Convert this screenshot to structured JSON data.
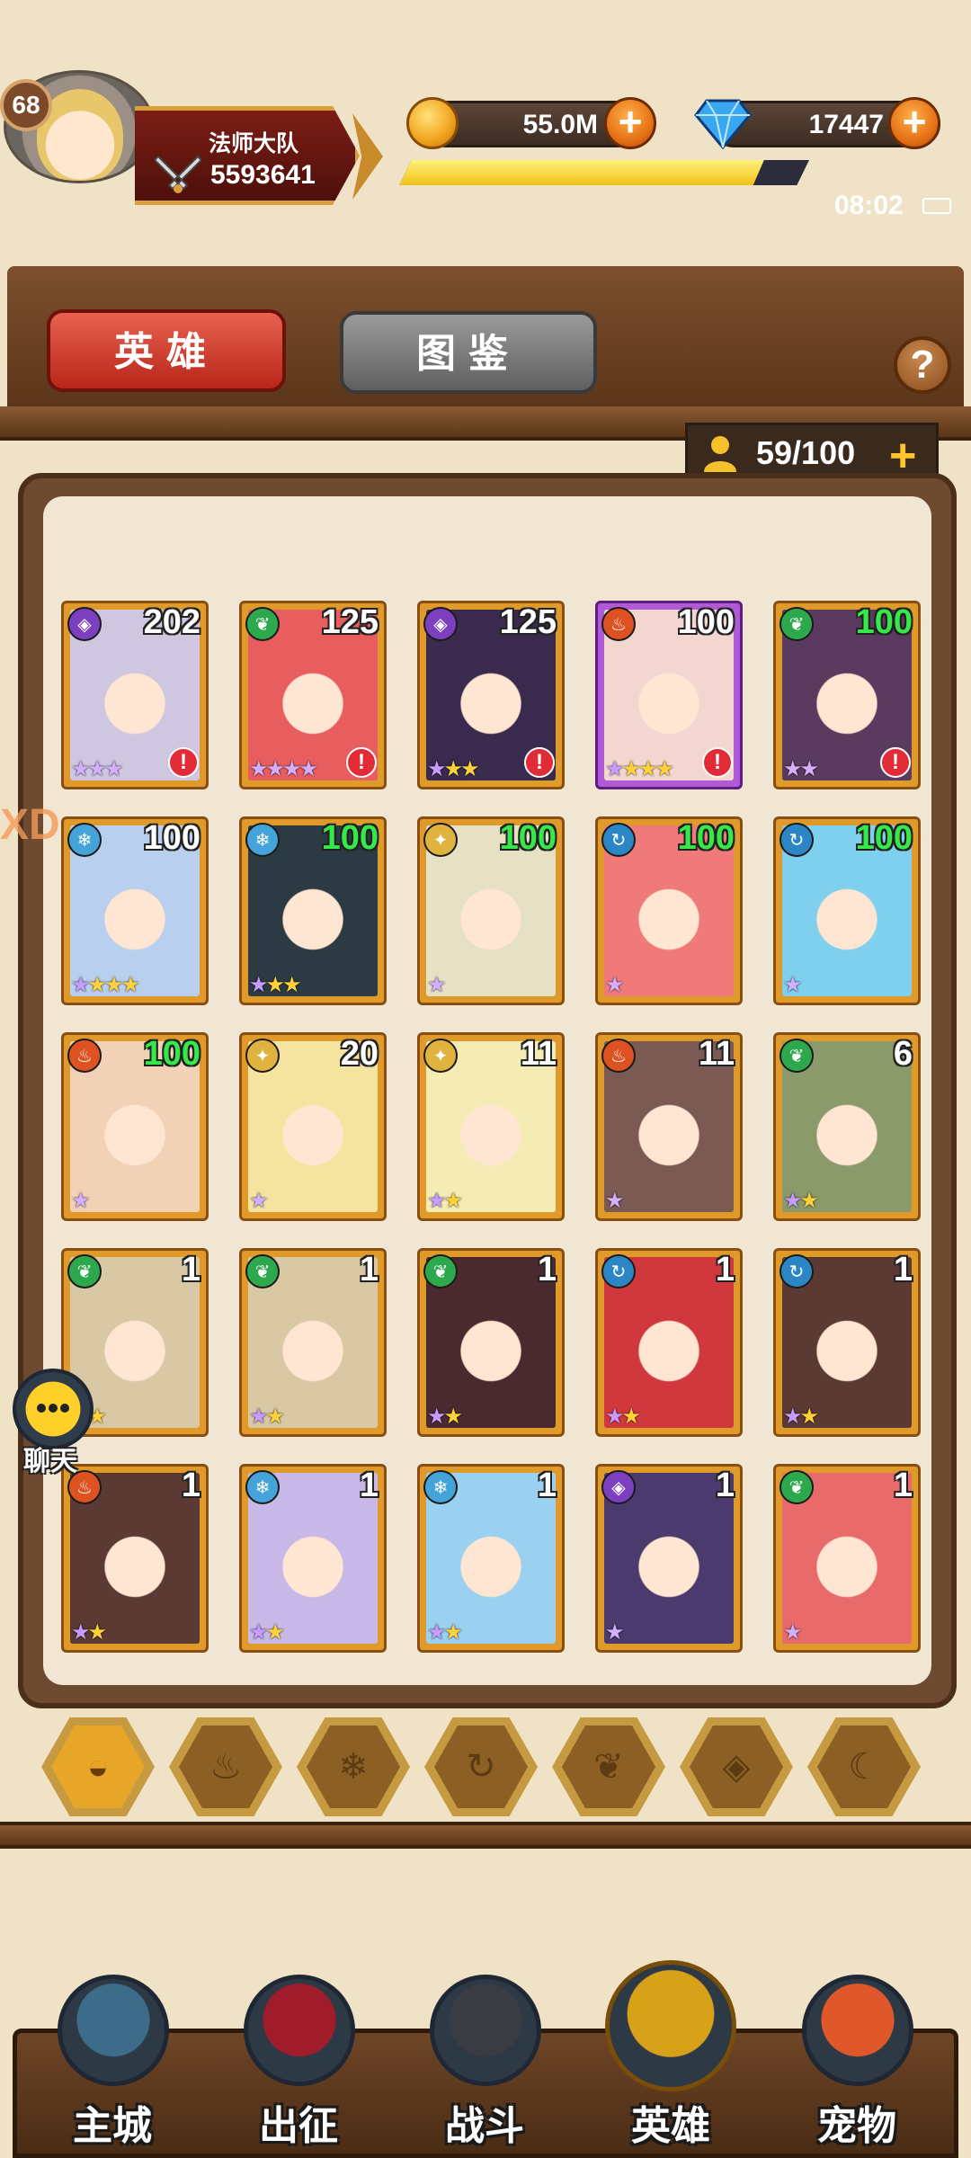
{
  "player": {
    "level": "68",
    "guild_name": "法师大队",
    "power": "5593641",
    "xp_fraction": 0.89
  },
  "resources": {
    "gold": "55.0M",
    "gems": "17447"
  },
  "status": {
    "time": "08:02"
  },
  "tabs": {
    "heroes": "英雄",
    "codex": "图鉴",
    "help": "?"
  },
  "capacity": {
    "text": "59/100",
    "plus": "+"
  },
  "left_edge_text": "XD",
  "chat": {
    "label": "聊天"
  },
  "filters": [
    "all-icon",
    "fire-icon",
    "ice-icon",
    "wind-icon",
    "nature-icon",
    "arcane-icon",
    "moon-icon"
  ],
  "heroes": [
    {
      "level": "202",
      "element": "arcane",
      "stars": 3,
      "star_color": "purple",
      "frame": "gold",
      "alert": true,
      "level_green": false,
      "art": "#cfc6e0"
    },
    {
      "level": "125",
      "element": "nature",
      "stars": 4,
      "star_color": "purple",
      "frame": "gold",
      "alert": true,
      "level_green": false,
      "art": "#e85d5d"
    },
    {
      "level": "125",
      "element": "arcane",
      "stars": 3,
      "star_color": "gold",
      "frame": "gold",
      "alert": true,
      "level_green": false,
      "art": "#3a2a4e"
    },
    {
      "level": "100",
      "element": "fire",
      "stars": 4,
      "star_color": "gold",
      "frame": "purple",
      "alert": true,
      "level_green": false,
      "art": "#f3d6d0"
    },
    {
      "level": "100",
      "element": "nature",
      "stars": 2,
      "star_color": "purple",
      "frame": "gold",
      "alert": true,
      "level_green": true,
      "art": "#5a3a5e"
    },
    {
      "level": "100",
      "element": "ice",
      "stars": 4,
      "star_color": "gold",
      "frame": "gold",
      "alert": false,
      "level_green": false,
      "art": "#b8cfee"
    },
    {
      "level": "100",
      "element": "ice",
      "stars": 3,
      "star_color": "gold",
      "frame": "gold",
      "alert": false,
      "level_green": true,
      "art": "#2c3a44"
    },
    {
      "level": "100",
      "element": "light",
      "stars": 1,
      "star_color": "purple",
      "frame": "gold",
      "alert": false,
      "level_green": true,
      "art": "#e6e0c4"
    },
    {
      "level": "100",
      "element": "wind",
      "stars": 1,
      "star_color": "purple",
      "frame": "gold",
      "alert": false,
      "level_green": true,
      "art": "#f07a7a"
    },
    {
      "level": "100",
      "element": "wind",
      "stars": 1,
      "star_color": "purple",
      "frame": "gold",
      "alert": false,
      "level_green": true,
      "art": "#7fd0ee"
    },
    {
      "level": "100",
      "element": "fire",
      "stars": 1,
      "star_color": "purple",
      "frame": "gold",
      "alert": false,
      "level_green": true,
      "art": "#f2d2b6"
    },
    {
      "level": "20",
      "element": "light",
      "stars": 1,
      "star_color": "purple",
      "frame": "gold",
      "alert": false,
      "level_green": false,
      "art": "#f5e3a0"
    },
    {
      "level": "11",
      "element": "light",
      "stars": 2,
      "star_color": "gold",
      "frame": "gold",
      "alert": false,
      "level_green": false,
      "art": "#f4ecb4"
    },
    {
      "level": "11",
      "element": "fire",
      "stars": 1,
      "star_color": "purple",
      "frame": "gold",
      "alert": false,
      "level_green": false,
      "art": "#7a5a52"
    },
    {
      "level": "6",
      "element": "nature",
      "stars": 2,
      "star_color": "gold",
      "frame": "gold",
      "alert": false,
      "level_green": false,
      "art": "#8a9a6a"
    },
    {
      "level": "1",
      "element": "nature",
      "stars": 2,
      "star_color": "gold",
      "frame": "gold",
      "alert": false,
      "level_green": false,
      "art": "#d8c8a4"
    },
    {
      "level": "1",
      "element": "nature",
      "stars": 2,
      "star_color": "gold",
      "frame": "gold",
      "alert": false,
      "level_green": false,
      "art": "#d8c8a4"
    },
    {
      "level": "1",
      "element": "nature",
      "stars": 2,
      "star_color": "gold",
      "frame": "gold",
      "alert": false,
      "level_green": false,
      "art": "#4a2a2e"
    },
    {
      "level": "1",
      "element": "wind",
      "stars": 2,
      "star_color": "gold",
      "frame": "gold",
      "alert": false,
      "level_green": false,
      "art": "#d0383e"
    },
    {
      "level": "1",
      "element": "wind",
      "stars": 2,
      "star_color": "gold",
      "frame": "gold",
      "alert": false,
      "level_green": false,
      "art": "#5a3a32"
    },
    {
      "level": "1",
      "element": "fire",
      "stars": 2,
      "star_color": "gold",
      "frame": "gold",
      "alert": false,
      "level_green": false,
      "art": "#5a3a32"
    },
    {
      "level": "1",
      "element": "ice",
      "stars": 2,
      "star_color": "gold",
      "frame": "gold",
      "alert": false,
      "level_green": false,
      "art": "#c8b8e8"
    },
    {
      "level": "1",
      "element": "ice",
      "stars": 2,
      "star_color": "gold",
      "frame": "gold",
      "alert": false,
      "level_green": false,
      "art": "#9ad0f0"
    },
    {
      "level": "1",
      "element": "arcane",
      "stars": 1,
      "star_color": "purple",
      "frame": "gold",
      "alert": false,
      "level_green": false,
      "art": "#4a3a6e"
    },
    {
      "level": "1",
      "element": "nature",
      "stars": 1,
      "star_color": "purple",
      "frame": "gold",
      "alert": false,
      "level_green": false,
      "art": "#e86a6a"
    }
  ],
  "nav": [
    {
      "label": "主城",
      "icon": "castle-icon",
      "color": "#3c6c8a"
    },
    {
      "label": "出征",
      "icon": "portal-icon",
      "color": "#a01c2a"
    },
    {
      "label": "战斗",
      "icon": "battle-shield-icon",
      "color": "#3a3c44"
    },
    {
      "label": "英雄",
      "icon": "winged-crest-icon",
      "color": "#d7a21a"
    },
    {
      "label": "宠物",
      "icon": "dragon-pet-icon",
      "color": "#e0582a"
    }
  ]
}
